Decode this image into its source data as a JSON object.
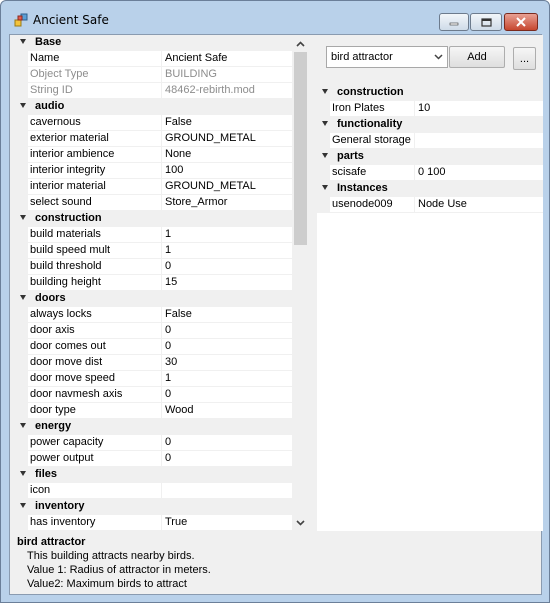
{
  "window": {
    "title": "Ancient Safe"
  },
  "left_grid": {
    "rows": [
      {
        "kind": "category",
        "label": "Base"
      },
      {
        "kind": "prop",
        "name": "Name",
        "value": "Ancient Safe",
        "readonly": false
      },
      {
        "kind": "prop",
        "name": "Object Type",
        "value": "BUILDING",
        "readonly": true
      },
      {
        "kind": "prop",
        "name": "String ID",
        "value": "48462-rebirth.mod",
        "readonly": true
      },
      {
        "kind": "category",
        "label": "audio"
      },
      {
        "kind": "prop",
        "name": "cavernous",
        "value": "False"
      },
      {
        "kind": "prop",
        "name": "exterior material",
        "value": "GROUND_METAL"
      },
      {
        "kind": "prop",
        "name": "interior ambience",
        "value": "None"
      },
      {
        "kind": "prop",
        "name": "interior integrity",
        "value": "100"
      },
      {
        "kind": "prop",
        "name": "interior material",
        "value": "GROUND_METAL"
      },
      {
        "kind": "prop",
        "name": "select sound",
        "value": "Store_Armor"
      },
      {
        "kind": "category",
        "label": "construction"
      },
      {
        "kind": "prop",
        "name": "build materials",
        "value": "1"
      },
      {
        "kind": "prop",
        "name": "build speed mult",
        "value": "1"
      },
      {
        "kind": "prop",
        "name": "build threshold",
        "value": "0"
      },
      {
        "kind": "prop",
        "name": "building height",
        "value": "15"
      },
      {
        "kind": "category",
        "label": "doors"
      },
      {
        "kind": "prop",
        "name": "always locks",
        "value": "False"
      },
      {
        "kind": "prop",
        "name": "door axis",
        "value": "0"
      },
      {
        "kind": "prop",
        "name": "door comes out",
        "value": "0"
      },
      {
        "kind": "prop",
        "name": "door move dist",
        "value": "30"
      },
      {
        "kind": "prop",
        "name": "door move speed",
        "value": "1"
      },
      {
        "kind": "prop",
        "name": "door navmesh axis",
        "value": "0"
      },
      {
        "kind": "prop",
        "name": "door type",
        "value": "Wood"
      },
      {
        "kind": "category",
        "label": "energy"
      },
      {
        "kind": "prop",
        "name": "power capacity",
        "value": "0"
      },
      {
        "kind": "prop",
        "name": "power output",
        "value": "0"
      },
      {
        "kind": "category",
        "label": "files"
      },
      {
        "kind": "prop",
        "name": "icon",
        "value": ""
      },
      {
        "kind": "category",
        "label": "inventory"
      },
      {
        "kind": "prop",
        "name": "has inventory",
        "value": "True"
      }
    ]
  },
  "toolbar": {
    "combo_value": "bird attractor",
    "add_label": "Add",
    "more_label": "..."
  },
  "right_grid": {
    "rows": [
      {
        "kind": "category",
        "label": "construction"
      },
      {
        "kind": "prop",
        "name": "Iron Plates",
        "value": "10"
      },
      {
        "kind": "category",
        "label": "functionality"
      },
      {
        "kind": "prop",
        "name": "General storage",
        "value": ""
      },
      {
        "kind": "category",
        "label": "parts"
      },
      {
        "kind": "prop",
        "name": "scisafe",
        "value": "0    100"
      },
      {
        "kind": "category",
        "label": "Instances"
      },
      {
        "kind": "prop",
        "name": "usenode009",
        "value": "Node Use"
      }
    ]
  },
  "help": {
    "title": "bird attractor",
    "lines": [
      "This building attracts nearby birds.",
      "Value 1: Radius of attractor in meters.",
      "Value2: Maximum birds to attract"
    ]
  }
}
